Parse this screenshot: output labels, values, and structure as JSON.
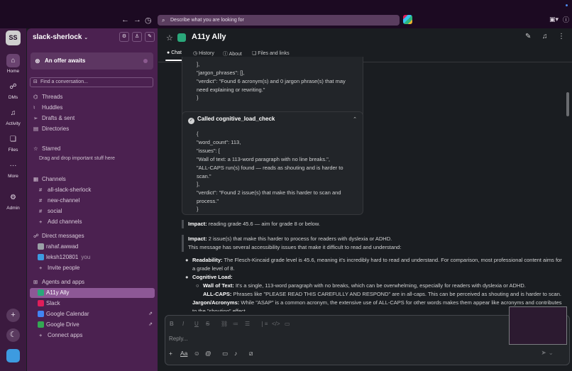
{
  "topbar": {
    "search_placeholder": "Describe what you are looking for"
  },
  "rail": {
    "workspace_initials": "SS",
    "items": [
      {
        "label": "Home"
      },
      {
        "label": "DMs"
      },
      {
        "label": "Activity"
      },
      {
        "label": "Files"
      },
      {
        "label": "More"
      },
      {
        "label": "Admin"
      }
    ]
  },
  "sidebar": {
    "workspace_name": "slack-sherlock",
    "offer": "An offer awaits",
    "find_placeholder": "Find a conversation...",
    "nav": [
      "Threads",
      "Huddles",
      "Drafts & sent",
      "Directories"
    ],
    "starred_label": "Starred",
    "starred_hint": "Drag and drop important stuff here",
    "channels_label": "Channels",
    "channels": [
      "all-slack-sherlock",
      "new-channel",
      "social"
    ],
    "add_channels": "Add channels",
    "dm_label": "Direct messages",
    "dms": [
      {
        "name": "rahaf.awwad",
        "suffix": ""
      },
      {
        "name": "leksh120801",
        "suffix": "you"
      }
    ],
    "invite": "Invite people",
    "apps_label": "Agents and apps",
    "apps": [
      "A11y Ally",
      "Slack",
      "Google Calendar",
      "Google Drive"
    ],
    "connect_apps": "Connect apps"
  },
  "channel": {
    "title": "A11y Ally",
    "tabs": [
      "Chat",
      "History",
      "About",
      "Files and links"
    ]
  },
  "messages": {
    "card1_lines": [
      "],",
      "\"jargon_phrases\": [],",
      "\"verdict\": \"Found 6 acronym(s) and 0 jargon phrase(s) that may need explaining or rewriting.\"",
      "}"
    ],
    "card2_title": "Called cognitive_load_check",
    "card2_lines": [
      "{",
      "\"word_count\": 113,",
      "\"issues\": [",
      "\"Wall of text: a 113-word paragraph with no line breaks.\",",
      "\"ALL-CAPS run(s) found — reads as shouting and is harder to scan.\"",
      "],",
      "\"verdict\": \"Found 2 issue(s) that make this harder to scan and process.\"",
      "}"
    ],
    "impact1_label": "Impact:",
    "impact1_text": " reading grade 45.6 — aim for grade 8 or below.",
    "impact2_label": "Impact:",
    "impact2_text": " 2 issue(s) that make this harder to process for readers with dyslexia or ADHD.",
    "impact2_line2": "This message has several accessibility issues that make it difficult to read and understand:",
    "bullets": [
      {
        "label": "Readability:",
        "text": " The Flesch-Kincaid grade level is 45.6, meaning it's incredibly hard to read and understand. For comparison, most professional content aims for a grade level of 8."
      },
      {
        "label": "Cognitive Load:",
        "text": ""
      },
      {
        "label": "Wall of Text:",
        "text": " It's a single, 113-word paragraph with no breaks, which can be overwhelming, especially for readers with dyslexia or ADHD."
      },
      {
        "label": "ALL-CAPS:",
        "text": " Phrases like \"PLEASE READ THIS CAREFULLY AND RESPOND\" are in all-caps. This can be perceived as shouting and is harder to scan."
      },
      {
        "label": "Jargon/Acronyms:",
        "text": " While \"ASAP\" is a common acronym, the extensive use of ALL-CAPS for other words makes them appear like acronyms and contributes to the \"shouting\" effect."
      }
    ]
  },
  "composer": {
    "placeholder": "Reply..."
  },
  "colors": {
    "sidebar_bg": "#4b2150",
    "rail_bg": "#3b1a3f",
    "selected_item": "#8d5896",
    "main_bg": "#1a1d21"
  }
}
